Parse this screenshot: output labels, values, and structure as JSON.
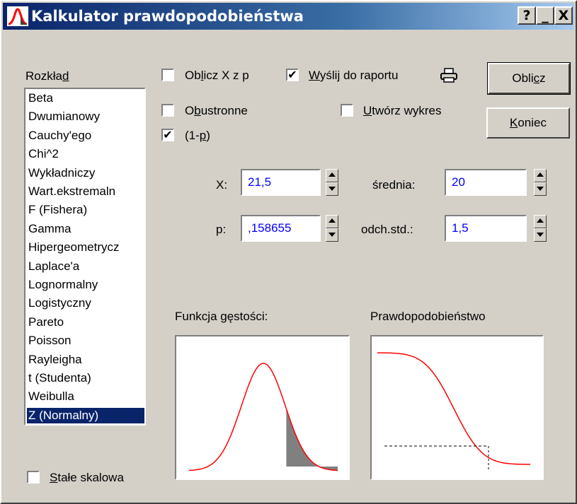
{
  "window": {
    "title": "Kalkulator prawdopodobieństwa",
    "help_label": "?",
    "minimize_label": "_",
    "close_label": "X"
  },
  "distribution": {
    "label_pre": "Rozkła",
    "label_u": "d",
    "items": [
      "Beta",
      "Dwumianowy",
      "Cauchy'ego",
      "Chi^2",
      "Wykładniczy",
      "Wart.ekstremaln",
      "F (Fishera)",
      "Gamma",
      "Hipergeometrycz",
      "Laplace'a",
      "Lognormalny",
      "Logistyczny",
      "Pareto",
      "Poisson",
      "Rayleigha",
      "t (Studenta)",
      "Weibulla",
      "Z (Normalny)"
    ],
    "selected_index": 17
  },
  "options": {
    "oblicz_x": {
      "pre": "Ob",
      "u": "l",
      "post": "icz X z p",
      "checked": false
    },
    "obustronne": {
      "pre": "O",
      "u": "b",
      "post": "ustronne",
      "checked": false
    },
    "one_minus_p": {
      "pre": "(1-",
      "u": "p",
      "post": ")",
      "checked": true,
      "mark": "✔"
    },
    "wyslij": {
      "pre": "",
      "u": "W",
      "post": "yślij do raportu",
      "checked": true,
      "mark": "✔"
    },
    "utworz": {
      "pre": "",
      "u": "U",
      "post": "twórz wykres",
      "checked": false
    },
    "stale": {
      "pre": "",
      "u": "S",
      "post": "tałe skalowa",
      "checked": false
    }
  },
  "buttons": {
    "oblicz": {
      "pre": "Obli",
      "u": "c",
      "post": "z"
    },
    "koniec": {
      "pre": "",
      "u": "K",
      "post": "oniec"
    }
  },
  "fields": {
    "x": {
      "label": "X:",
      "value": "21,5"
    },
    "p": {
      "label": "p:",
      "value": ",158655"
    },
    "srednia": {
      "label": "średnia:",
      "value": "20"
    },
    "odch": {
      "label": "odch.std.:",
      "value": "1,5"
    }
  },
  "plots": {
    "density_title": "Funkcja gęstości:",
    "probability_title": "Prawdopodobieństwo"
  },
  "colors": {
    "title_start": "#0a246a",
    "title_end": "#a6caf0",
    "curve": "#ff0000",
    "value_text": "#0000ff",
    "shade": "#808080"
  }
}
